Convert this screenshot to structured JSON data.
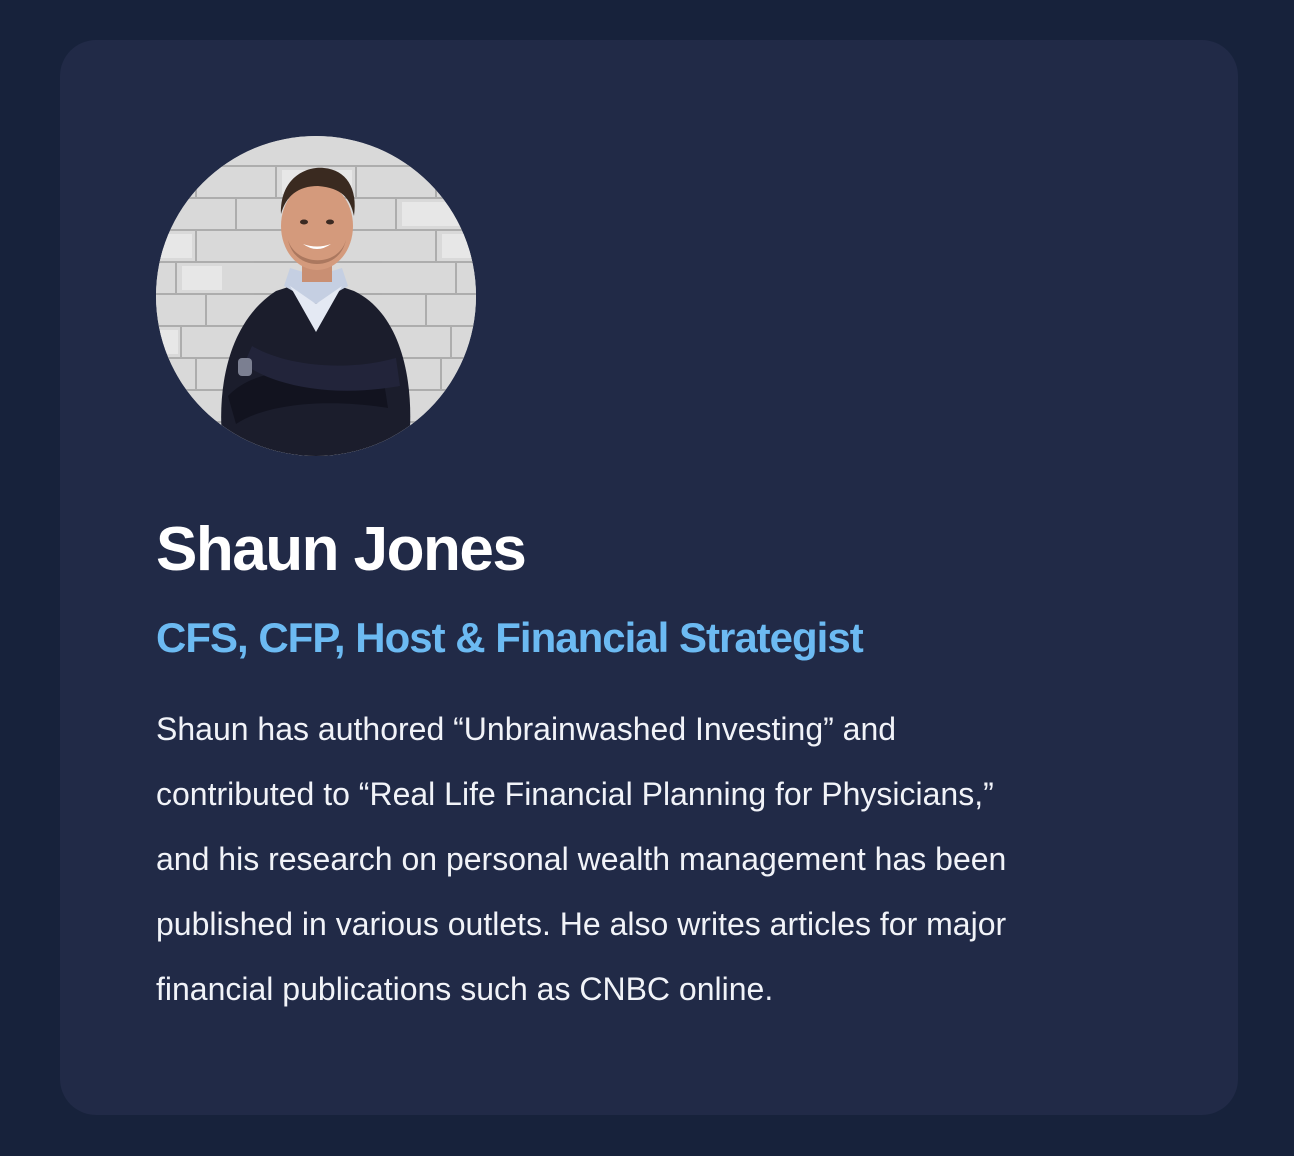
{
  "profile": {
    "avatar_icon": "person-portrait",
    "name": "Shaun Jones",
    "title": "CFS, CFP, Host & Financial Strategist",
    "bio_lines": [
      "Shaun has authored “Unbrainwashed Investing” and",
      "contributed to “Real Life Financial Planning for Physicians,”",
      "and his research on personal wealth management has been",
      "published in various outlets. He also writes articles for major",
      "financial publications such as CNBC online."
    ]
  },
  "colors": {
    "page_background": "#17223b",
    "card_background": "#212a47",
    "name_text": "#ffffff",
    "title_accent": "#6cbaf2",
    "body_text": "#f1f3f8"
  }
}
